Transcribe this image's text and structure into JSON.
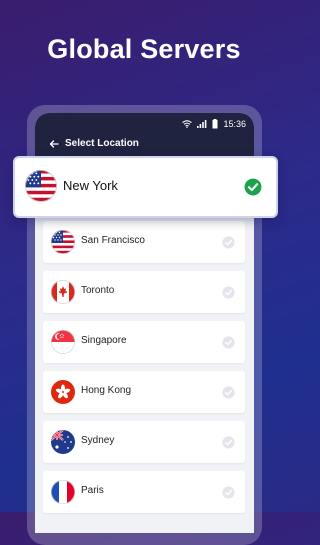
{
  "headline": "Global Servers",
  "status_bar": {
    "time": "15:36"
  },
  "header": {
    "title": "Select Location"
  },
  "selected": {
    "name": "New York",
    "flag": "flag-us-icon"
  },
  "locations": [
    {
      "name": "San Francisco",
      "flag": "flag-us-icon"
    },
    {
      "name": "Toronto",
      "flag": "flag-canada-icon"
    },
    {
      "name": "Singapore",
      "flag": "flag-singapore-icon"
    },
    {
      "name": "Hong Kong",
      "flag": "flag-hong-kong-icon"
    },
    {
      "name": "Sydney",
      "flag": "flag-australia-icon"
    },
    {
      "name": "Paris",
      "flag": "flag-france-icon"
    }
  ],
  "colors": {
    "accent_check": "#1aa34a",
    "app_bar": "#1f2340",
    "background_top": "#3a1d6e",
    "background_bottom": "#1f2f8f"
  }
}
